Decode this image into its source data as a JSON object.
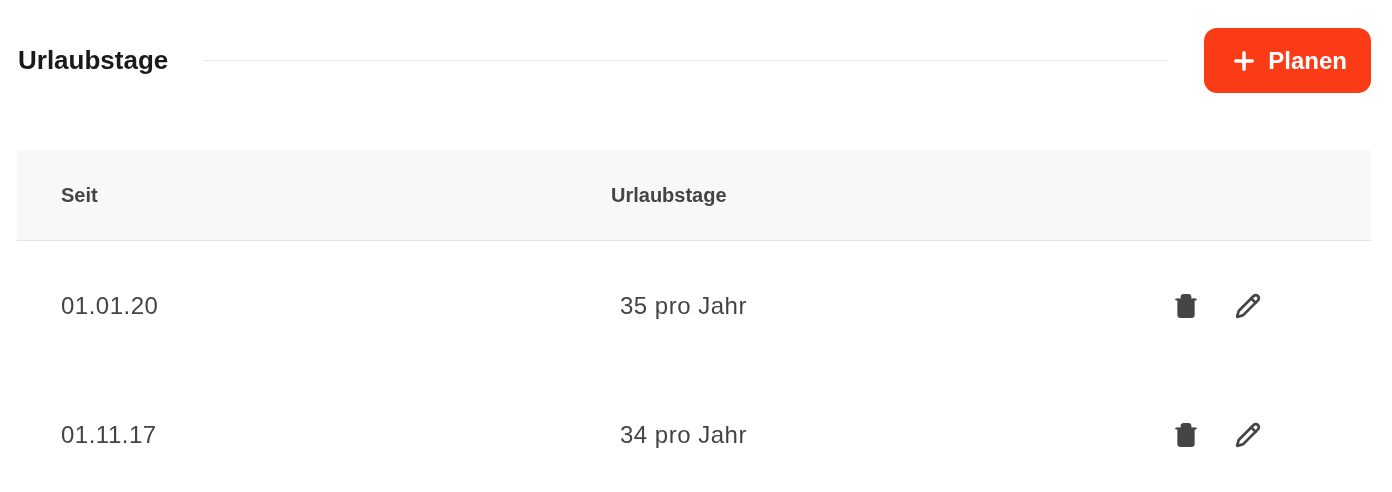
{
  "header": {
    "title": "Urlaubstage",
    "button": "Planen"
  },
  "table": {
    "columns": [
      "Seit",
      "Urlaubstage"
    ],
    "rows": [
      {
        "since": "01.01.20",
        "days": "35 pro Jahr"
      },
      {
        "since": "01.11.17",
        "days": "34 pro Jahr"
      }
    ]
  }
}
